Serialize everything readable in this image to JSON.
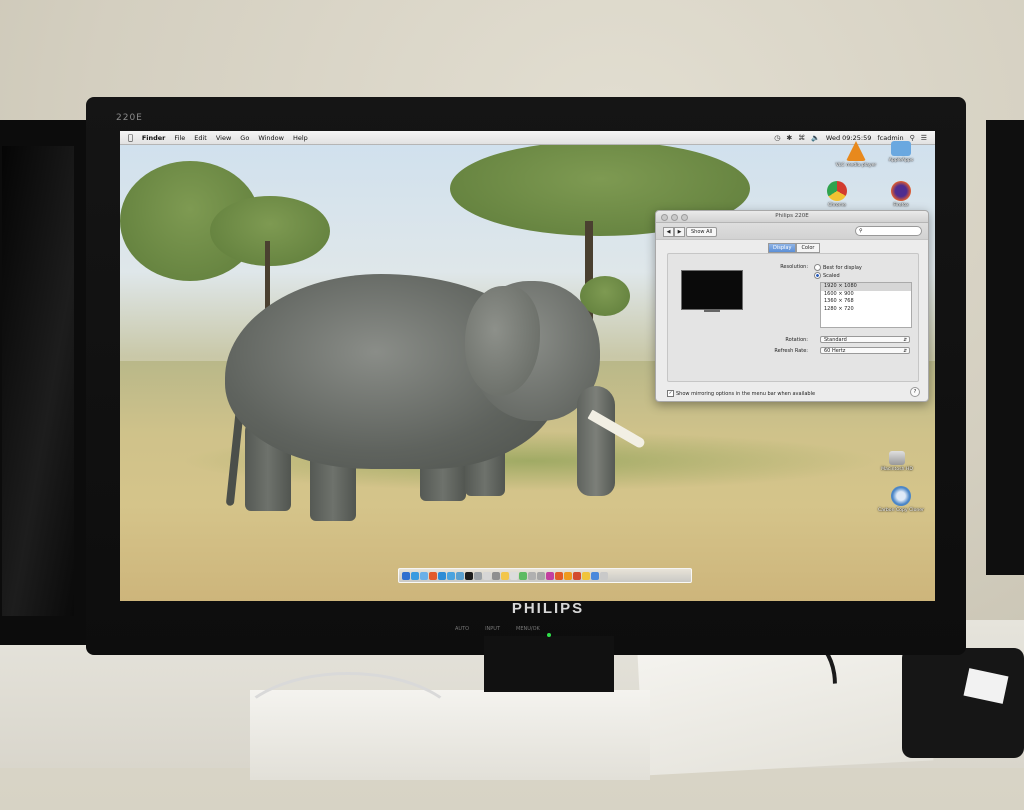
{
  "monitor": {
    "model_label": "220E",
    "brand": "PHILIPS",
    "buttons": [
      "AUTO",
      "INPUT",
      "MENU/OK"
    ]
  },
  "menubar": {
    "apple_icon": "apple-logo-icon",
    "items": [
      "Finder",
      "File",
      "Edit",
      "View",
      "Go",
      "Window",
      "Help"
    ],
    "clock": "Wed 09:25:59",
    "user": "fcadmin"
  },
  "desktop_icons": [
    {
      "label": "VLC media player",
      "icon": "vlc-icon",
      "color": "#e8891d"
    },
    {
      "label": "AppleApps",
      "icon": "folder-icon",
      "color": "#6aa8e0"
    },
    {
      "label": "Chrome",
      "icon": "chrome-icon",
      "color": "#d23b2e"
    },
    {
      "label": "Firefox",
      "icon": "firefox-icon",
      "color": "#4f2d8f"
    },
    {
      "label": "Macintosh HD",
      "icon": "hard-disk-icon",
      "color": "#b9b9b9"
    },
    {
      "label": "Carbon Copy Cloner",
      "icon": "carbon-copy-cloner-icon",
      "color": "#4b86c7"
    }
  ],
  "prefs_window": {
    "title": "Philips 220E",
    "show_all": "Show All",
    "search_placeholder": "",
    "tabs": [
      "Display",
      "Color"
    ],
    "active_tab": "Display",
    "resolution_label": "Resolution:",
    "option_best": "Best for display",
    "option_scaled": "Scaled",
    "resolutions": [
      "1920 × 1080",
      "1600 × 900",
      "1360 × 768",
      "1280 × 720"
    ],
    "selected_resolution": "1920 × 1080",
    "rotation_label": "Rotation:",
    "rotation_value": "Standard",
    "refresh_label": "Refresh Rate:",
    "refresh_value": "60 Hertz",
    "mirroring_checkbox": "Show mirroring options in the menu bar when available",
    "help": "?"
  },
  "dock": {
    "apps": [
      "#2f6fcf",
      "#3a9be0",
      "#6bb0e8",
      "#e35b2a",
      "#2d8cd6",
      "#4aa3df",
      "#5aa0d0",
      "#1c1c1c",
      "#9aa0a6",
      "#d6d6d6",
      "#8f8f8f",
      "#f3c64a",
      "#dcdcdc",
      "#5dbb63",
      "#b0b0b0",
      "#a6a6a6",
      "#c33fa0",
      "#e25b27",
      "#ef9a1e",
      "#d34a2e",
      "#f0c43c",
      "#4a89dc",
      "#c9c9c9"
    ]
  },
  "colors": {
    "menubar": "#ececec",
    "selection_blue": "#5b8fd6",
    "power_led": "#2fe04a"
  }
}
